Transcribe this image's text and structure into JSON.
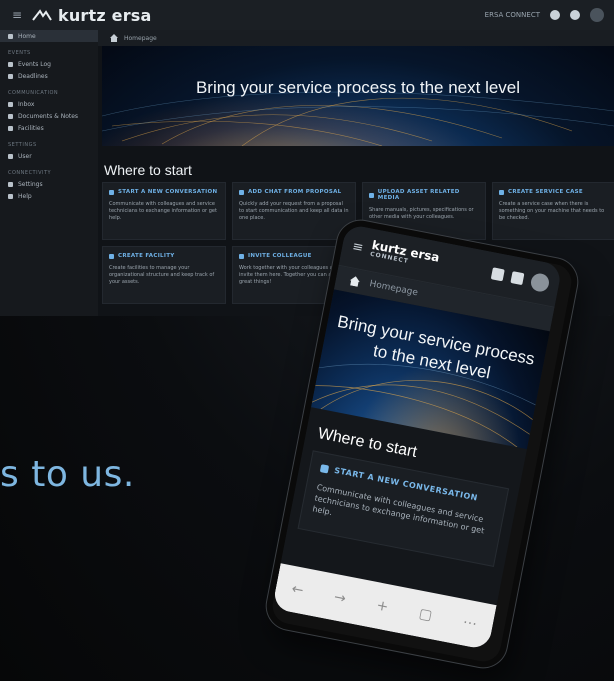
{
  "desktop": {
    "app_title": "kurtz ersa",
    "connect_label": "ERSA CONNECT",
    "breadcrumb": "Homepage",
    "hero_title": "Bring your service process to the next level",
    "section_title": "Where to start",
    "sidebar": {
      "items_top": [
        {
          "label": "Home",
          "icon": "home-icon",
          "active": true
        }
      ],
      "section1": "EVENTS",
      "items1": [
        {
          "label": "Events Log",
          "icon": "list-icon"
        },
        {
          "label": "Deadlines",
          "icon": "clock-icon"
        }
      ],
      "section2": "COMMUNICATION",
      "items2": [
        {
          "label": "Inbox",
          "icon": "chat-icon"
        },
        {
          "label": "Documents & Notes",
          "icon": "doc-icon"
        },
        {
          "label": "Facilities",
          "icon": "building-icon"
        }
      ],
      "section3": "SETTINGS",
      "items3": [
        {
          "label": "User",
          "icon": "user-icon"
        }
      ],
      "section4": "CONNECTIVITY",
      "items4": [
        {
          "label": "Settings",
          "icon": "gear-icon"
        },
        {
          "label": "Help",
          "icon": "help-icon"
        }
      ]
    },
    "cards": [
      {
        "title": "START A NEW CONVERSATION",
        "body": "Communicate with colleagues and service technicians to exchange information or get help."
      },
      {
        "title": "ADD CHAT FROM PROPOSAL",
        "body": "Quickly add your request from a proposal to start communication and keep all data in one place."
      },
      {
        "title": "UPLOAD ASSET RELATED MEDIA",
        "body": "Share manuals, pictures, specifications or other media with your colleagues."
      },
      {
        "title": "CREATE SERVICE CASE",
        "body": "Create a service case when there is something on your machine that needs to be checked."
      },
      {
        "title": "CREATE FACILITY",
        "body": "Create facilities to manage your organizational structure and keep track of your assets."
      },
      {
        "title": "INVITE COLLEAGUE",
        "body": "Work together with your colleagues and invite them here. Together you can achieve great things!"
      }
    ]
  },
  "tagline": "s to us.",
  "phone": {
    "logo": "kurtz ersa",
    "logo_sub": "CONNECT",
    "breadcrumb": "Homepage",
    "hero_title": "Bring your service process to the next level",
    "section_title": "Where to start",
    "card_title": "START A NEW CONVERSATION",
    "card_body": "Communicate with colleagues and service technicians to exchange information or get help."
  }
}
